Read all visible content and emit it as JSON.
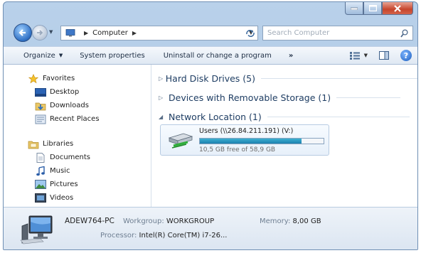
{
  "window": {
    "buttons": {
      "minimize": "minimize-icon",
      "maximize": "maximize-icon",
      "close": "close-icon"
    }
  },
  "address_bar": {
    "crumbs": [
      "Computer"
    ],
    "search_placeholder": "Search Computer"
  },
  "command_bar": {
    "organize": "Organize",
    "system_properties": "System properties",
    "uninstall": "Uninstall or change a program",
    "more": "»"
  },
  "nav_pane": {
    "favorites": {
      "label": "Favorites",
      "items": [
        "Desktop",
        "Downloads",
        "Recent Places"
      ]
    },
    "libraries": {
      "label": "Libraries",
      "items": [
        "Documents",
        "Music",
        "Pictures",
        "Videos"
      ]
    }
  },
  "main": {
    "groups": [
      {
        "label": "Hard Disk Drives (5)",
        "expanded": false
      },
      {
        "label": "Devices with Removable Storage (1)",
        "expanded": false
      },
      {
        "label": "Network Location (1)",
        "expanded": true
      }
    ],
    "drive": {
      "name": "Users (\\\\26.84.211.191) (V:)",
      "free_text": "10,5 GB free of 58,9 GB",
      "used_fraction": 0.82,
      "bar_color": "#1c7fae"
    }
  },
  "details": {
    "computer_name": "ADEW764-PC",
    "workgroup_label": "Workgroup:",
    "workgroup_value": "WORKGROUP",
    "memory_label": "Memory:",
    "memory_value": "8,00 GB",
    "processor_label": "Processor:",
    "processor_value": "Intel(R) Core(TM) i7-26..."
  }
}
